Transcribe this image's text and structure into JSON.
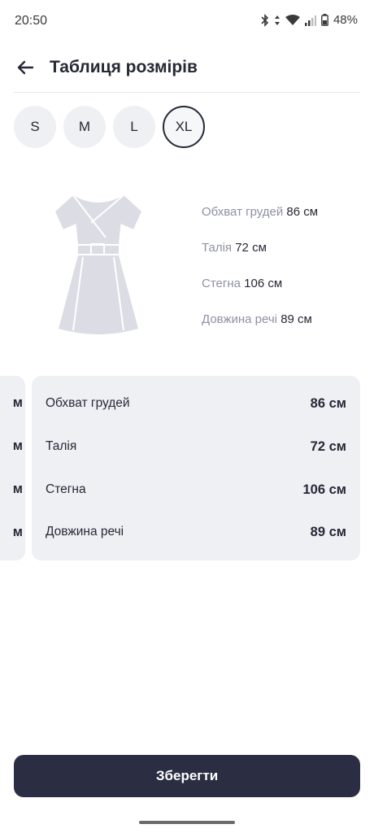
{
  "status_bar": {
    "time": "20:50",
    "battery": "48%"
  },
  "header": {
    "title": "Таблиця розмірів",
    "back_icon": "arrow-left-icon"
  },
  "sizes": {
    "items": [
      "S",
      "M",
      "L",
      "XL"
    ],
    "selected": "XL"
  },
  "illustration": {
    "icon": "dress-icon"
  },
  "measures": [
    {
      "label": "Обхват грудей",
      "value": "86 см"
    },
    {
      "label": "Талія",
      "value": "72 см"
    },
    {
      "label": "Стегна",
      "value": "106 см"
    },
    {
      "label": "Довжина речі",
      "value": "89 см"
    }
  ],
  "prev_card": {
    "rows": [
      "м",
      "м",
      "м",
      "м"
    ]
  },
  "card": {
    "rows": [
      {
        "label": "Обхват грудей",
        "value": "86 см"
      },
      {
        "label": "Талія",
        "value": "72 см"
      },
      {
        "label": "Стегна",
        "value": "106 см"
      },
      {
        "label": "Довжина речі",
        "value": "89 см"
      }
    ]
  },
  "actions": {
    "save_label": "Зберегти"
  },
  "colors": {
    "accent": "#2b2e42",
    "card_bg": "#eff0f4",
    "muted_text": "#8e90a3"
  }
}
